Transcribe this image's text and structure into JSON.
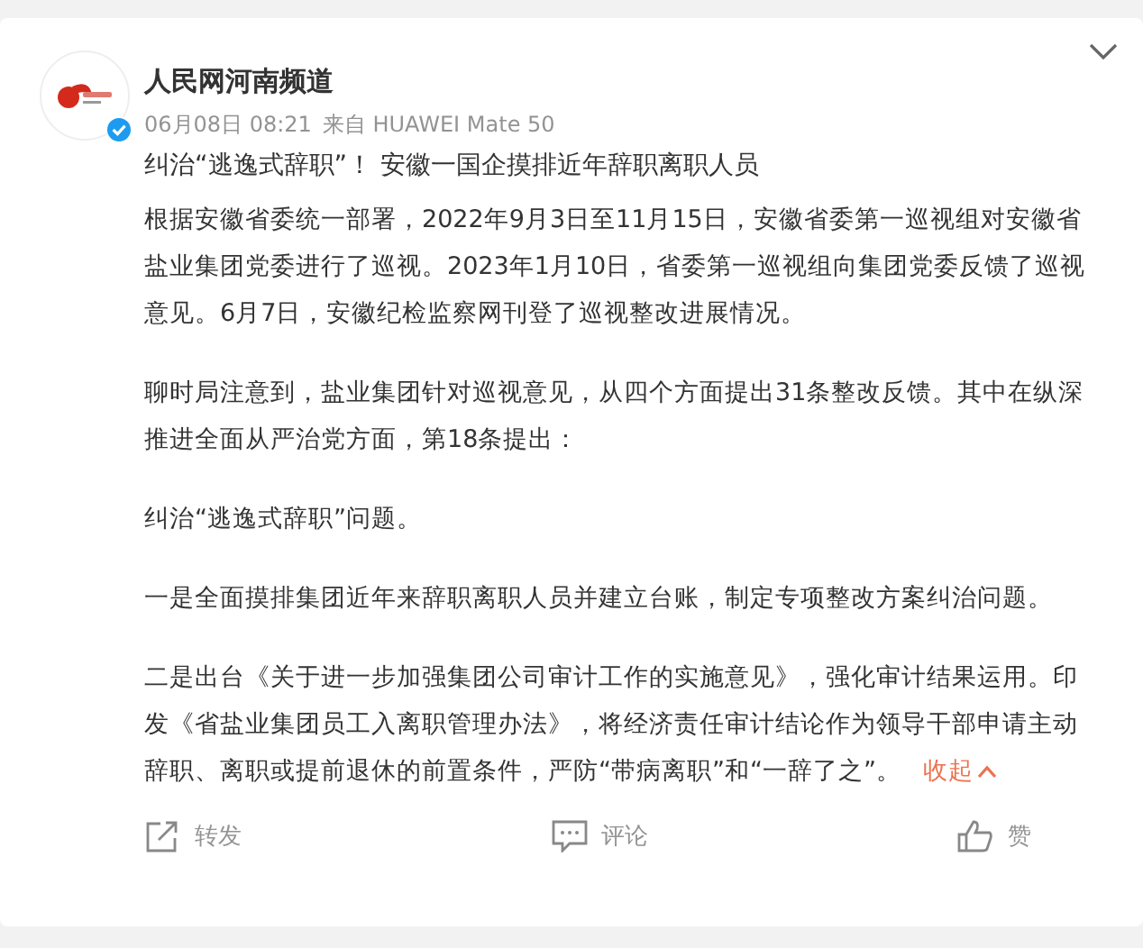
{
  "post": {
    "author": "人民网河南频道",
    "verified": true,
    "time": "06月08日 08:21",
    "source": "来自 HUAWEI Mate 50",
    "title": "纠治“逃逸式辞职”！ 安徽一国企摸排近年辞职离职人员",
    "paragraphs": [
      "根据安徽省委统一部署，2022年9月3日至11月15日，安徽省委第一巡视组对安徽省盐业集团党委进行了巡视。2023年1月10日，省委第一巡视组向集团党委反馈了巡视意见。6月7日，安徽纪检监察网刊登了巡视整改进展情况。",
      "聊时局注意到，盐业集团针对巡视意见，从四个方面提出31条整改反馈。其中在纵深推进全面从严治党方面，第18条提出：",
      "纠治“逃逸式辞职”问题。",
      "一是全面摸排集团近年来辞职离职人员并建立台账，制定专项整改方案纠治问题。",
      "二是出台《关于进一步加强集团公司审计工作的实施意见》，强化审计结果运用。印发《省盐业集团员工入离职管理办法》，将经济责任审计结论作为领导干部申请主动辞职、离职或提前退休的前置条件，严防“带病离职”和“一辞了之”。"
    ],
    "collapse": "收起"
  },
  "actions": [
    {
      "kind": "share",
      "label": "转发"
    },
    {
      "kind": "comment",
      "label": "评论"
    },
    {
      "kind": "like",
      "label": "赞"
    }
  ]
}
